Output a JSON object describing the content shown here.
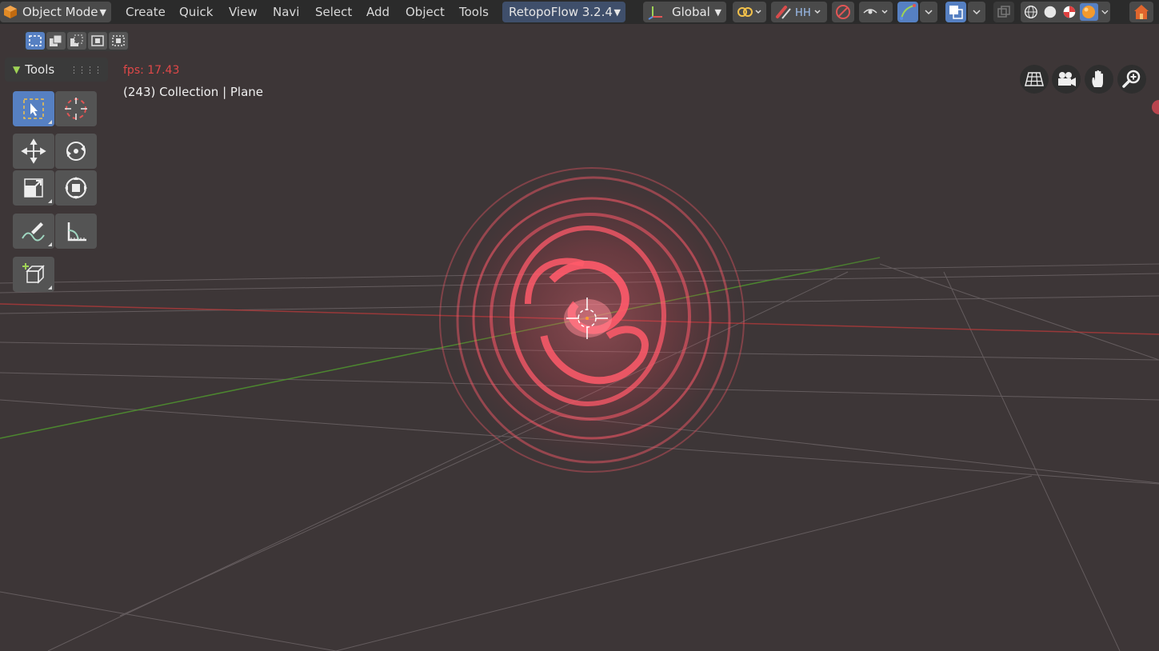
{
  "header": {
    "mode_label": "Object Mode",
    "menu": [
      "Create",
      "Quick",
      "View",
      "Navi",
      "Select",
      "Add",
      "Object",
      "Tools"
    ],
    "addon_label": "RetopoFlow 3.2.4",
    "orientation_label": "Global"
  },
  "tools": {
    "panel_title": "Tools"
  },
  "viewport": {
    "fps_text": "fps: 17.43",
    "collection_text": "(243) Collection | Plane"
  },
  "colors": {
    "header_bg": "#2b2b2b",
    "viewport_bg": "#3d3637",
    "accent": "#5680c2",
    "fps_text": "#e04848",
    "swirl": "#ff5a6a",
    "x_axis": "#c03a3a",
    "y_axis": "#4e8f2f"
  },
  "icons": [
    "object-cube-icon",
    "transform-orientation-icon",
    "pivot-icon",
    "snap-magnet-icon",
    "proportional-edit-icon",
    "visibility-icon",
    "gizmo-icon",
    "overlay-icon",
    "xray-icon",
    "wireframe-shading-icon",
    "solid-shading-icon",
    "material-shading-icon",
    "rendered-shading-icon",
    "home-icon",
    "grid-view-icon",
    "camera-view-icon",
    "hand-pan-icon",
    "zoom-icon",
    "select-box-icon",
    "cursor-icon",
    "move-icon",
    "rotate-icon",
    "scale-icon",
    "transform-icon",
    "annotate-icon",
    "measure-icon",
    "add-cube-icon"
  ]
}
